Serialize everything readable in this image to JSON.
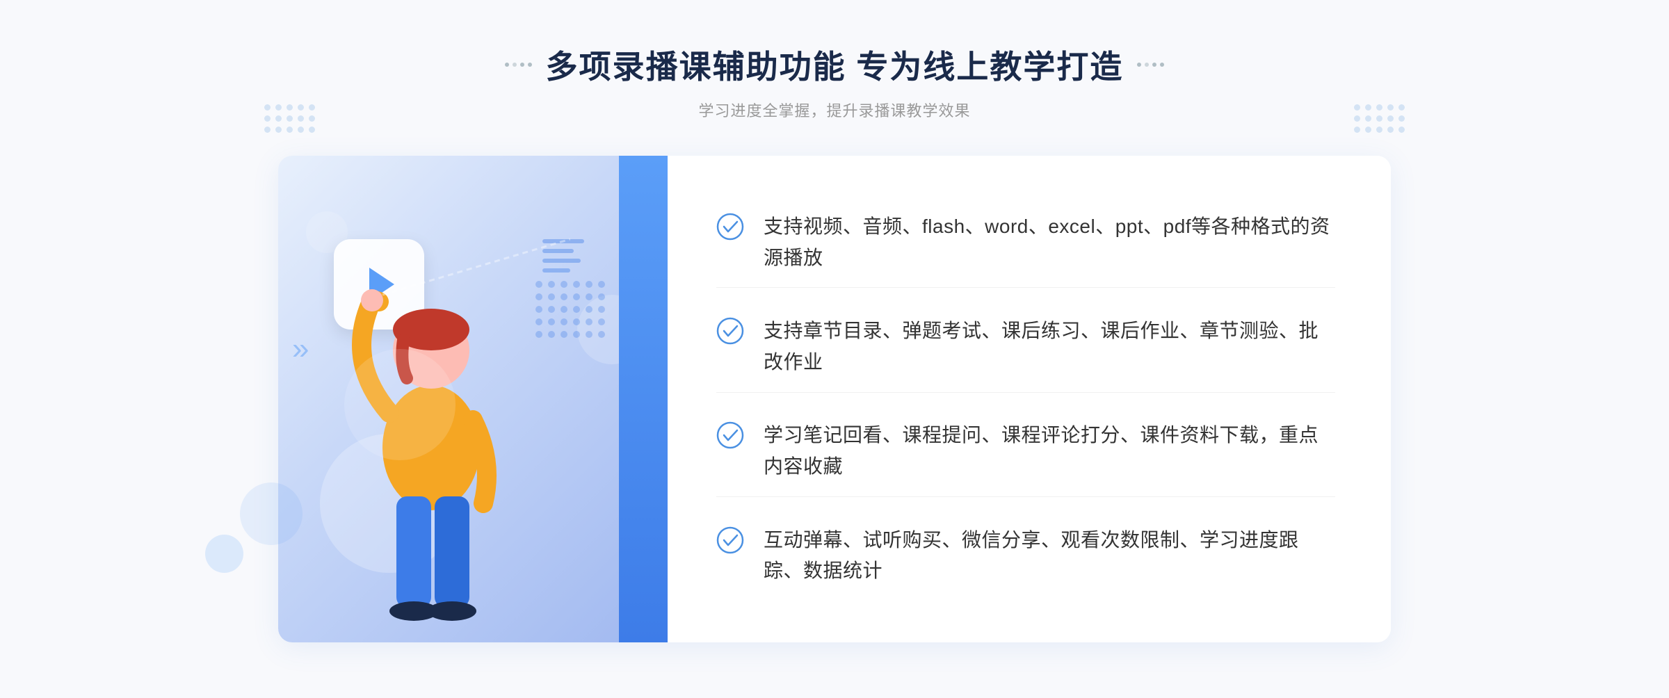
{
  "header": {
    "title": "多项录播课辅助功能 专为线上教学打造",
    "subtitle": "学习进度全掌握，提升录播课教学效果",
    "title_deco_left": "decorative dots",
    "title_deco_right": "decorative dots"
  },
  "features": [
    {
      "id": 1,
      "text": "支持视频、音频、flash、word、excel、ppt、pdf等各种格式的资源播放"
    },
    {
      "id": 2,
      "text": "支持章节目录、弹题考试、课后练习、课后作业、章节测验、批改作业"
    },
    {
      "id": 3,
      "text": "学习笔记回看、课程提问、课程评论打分、课件资料下载，重点内容收藏"
    },
    {
      "id": 4,
      "text": "互动弹幕、试听购买、微信分享、观看次数限制、学习进度跟踪、数据统计"
    }
  ],
  "colors": {
    "accent_blue": "#4a90e2",
    "title_dark": "#1a2a4a",
    "text_gray": "#333333",
    "subtitle_gray": "#999999",
    "panel_blue_light": "#e8f0fc",
    "check_blue": "#4a90e2"
  },
  "icons": {
    "play": "▶",
    "check": "check-circle",
    "chevron": "»"
  }
}
